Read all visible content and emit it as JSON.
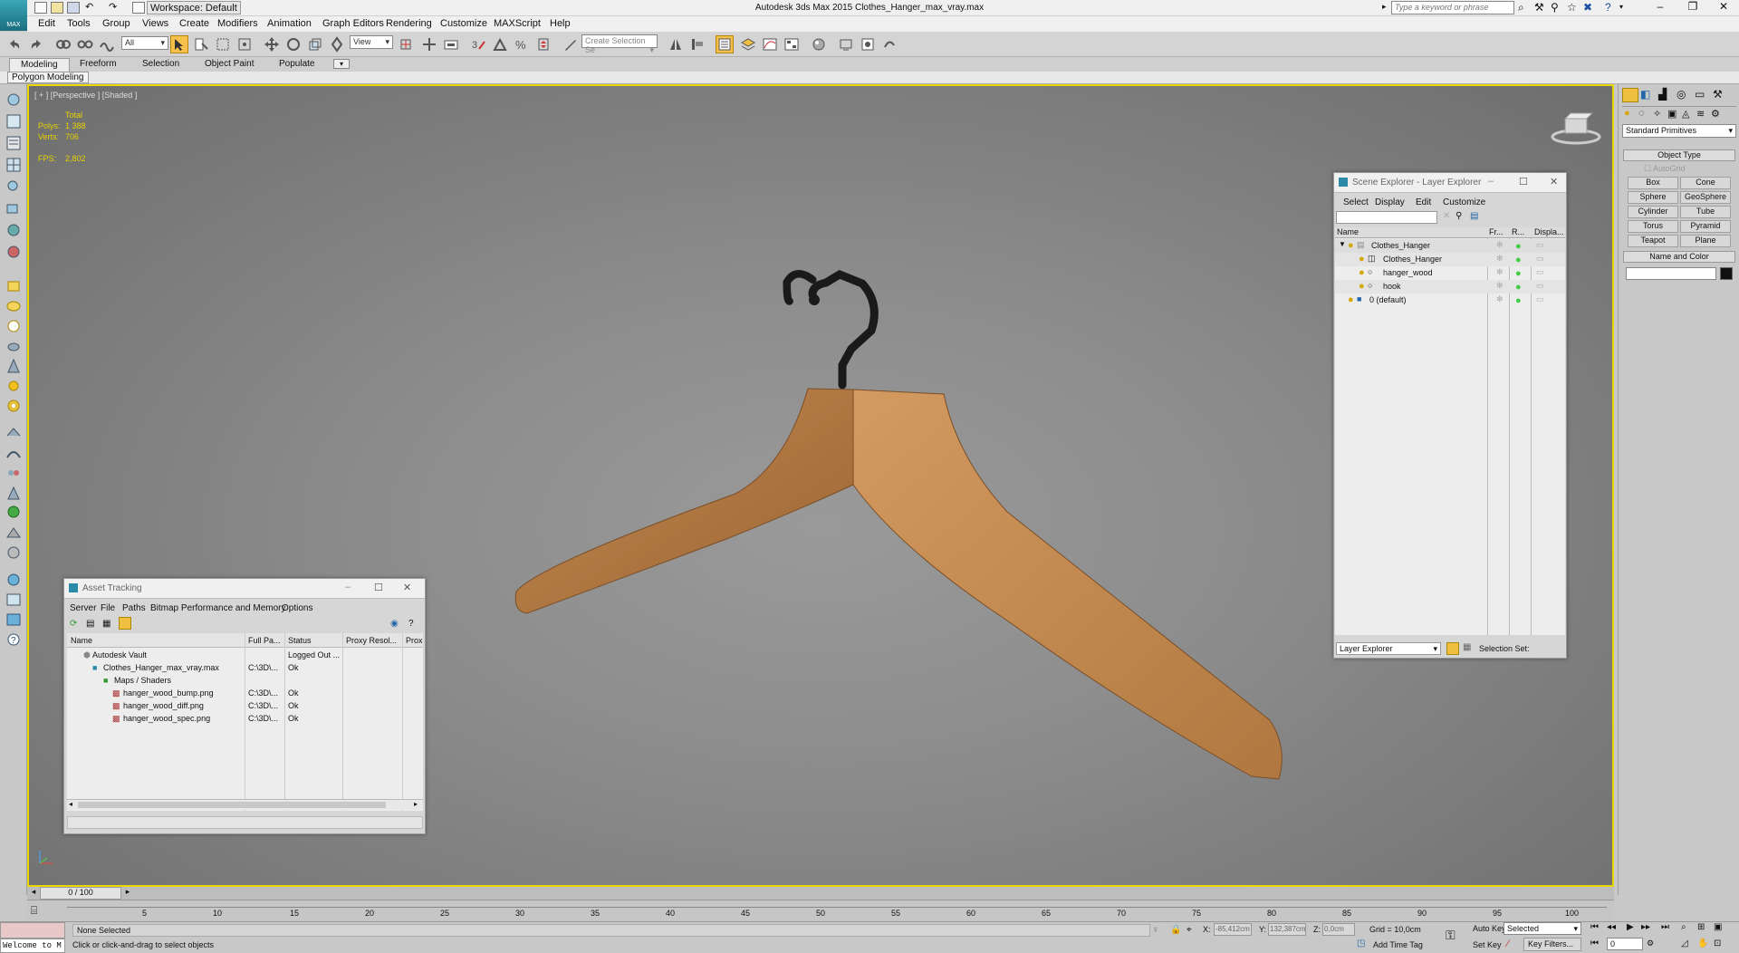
{
  "app": {
    "logo_text": "MAX",
    "workspace": "Workspace: Default",
    "title": "Autodesk 3ds Max  2015     Clothes_Hanger_max_vray.max",
    "search_placeholder": "Type a keyword or phrase"
  },
  "menus": [
    "Edit",
    "Tools",
    "Group",
    "Views",
    "Create",
    "Modifiers",
    "Animation",
    "Graph Editors",
    "Rendering",
    "Customize",
    "MAXScript",
    "Help"
  ],
  "toolbar": {
    "filter_value": "All",
    "ref_coord": "View",
    "selection_set_placeholder": "Create Selection Se"
  },
  "ribbon": {
    "tabs": [
      "Modeling",
      "Freeform",
      "Selection",
      "Object Paint",
      "Populate"
    ],
    "active_tab": "Modeling",
    "panel_label": "Polygon Modeling"
  },
  "viewport": {
    "label": "[ + ] [Perspective ] [Shaded ]",
    "stats": {
      "header": "Total",
      "polys_label": "Polys:",
      "polys_value": "1 388",
      "verts_label": "Verts:",
      "verts_value": "706",
      "fps_label": "FPS:",
      "fps_value": "2,802"
    }
  },
  "scene_explorer": {
    "title": "Scene Explorer - Layer Explorer",
    "menus": [
      "Select",
      "Display",
      "Edit",
      "Customize"
    ],
    "columns": [
      "Name",
      "Fr...",
      "R...",
      "Displa..."
    ],
    "items": [
      {
        "name": "Clothes_Hanger",
        "level": 0
      },
      {
        "name": "Clothes_Hanger",
        "level": 1
      },
      {
        "name": "hanger_wood",
        "level": 1
      },
      {
        "name": "hook",
        "level": 1
      },
      {
        "name": "0 (default)",
        "level": 0
      }
    ],
    "footer_dropdown": "Layer Explorer",
    "selection_set_label": "Selection Set:"
  },
  "asset_tracking": {
    "title": "Asset Tracking",
    "menus": [
      "Server",
      "File",
      "Paths",
      "Bitmap Performance and Memory",
      "Options"
    ],
    "columns": [
      "Name",
      "Full Pa...",
      "Status",
      "Proxy Resol...",
      "Prox"
    ],
    "rows": [
      {
        "name": "Autodesk Vault",
        "path": "",
        "status": "Logged Out ...",
        "level": 1
      },
      {
        "name": "Clothes_Hanger_max_vray.max",
        "path": "C:\\3D\\...",
        "status": "Ok",
        "level": 2
      },
      {
        "name": "Maps / Shaders",
        "path": "",
        "status": "",
        "level": 3
      },
      {
        "name": "hanger_wood_bump.png",
        "path": "C:\\3D\\...",
        "status": "Ok",
        "level": 4
      },
      {
        "name": "hanger_wood_diff.png",
        "path": "C:\\3D\\...",
        "status": "Ok",
        "level": 4
      },
      {
        "name": "hanger_wood_spec.png",
        "path": "C:\\3D\\...",
        "status": "Ok",
        "level": 4
      }
    ]
  },
  "command_panel": {
    "category": "Standard Primitives",
    "object_type_title": "Object Type",
    "autogrid_label": "AutoGrid",
    "buttons": [
      "Box",
      "Cone",
      "Sphere",
      "GeoSphere",
      "Cylinder",
      "Tube",
      "Torus",
      "Pyramid",
      "Teapot",
      "Plane"
    ],
    "name_color_title": "Name and Color"
  },
  "timeline": {
    "frame_label": "0 / 100",
    "ticks": [
      "5",
      "10",
      "15",
      "20",
      "25",
      "30",
      "35",
      "40",
      "45",
      "50",
      "55",
      "60",
      "65",
      "70",
      "75",
      "80",
      "85",
      "90",
      "95",
      "100"
    ]
  },
  "status": {
    "maxscript_text": "Welcome to M",
    "selection": "None Selected",
    "prompt": "Click or click-and-drag to select objects",
    "x_label": "X:",
    "x_value": "-85,412cm",
    "y_label": "Y:",
    "y_value": "132,387cm",
    "z_label": "Z:",
    "z_value": "0,0cm",
    "grid": "Grid = 10,0cm",
    "add_time_tag": "Add Time Tag",
    "auto_key": "Auto Key",
    "set_key": "Set Key",
    "key_mode": "Selected",
    "key_filters": "Key Filters...",
    "frame_value": "0"
  }
}
